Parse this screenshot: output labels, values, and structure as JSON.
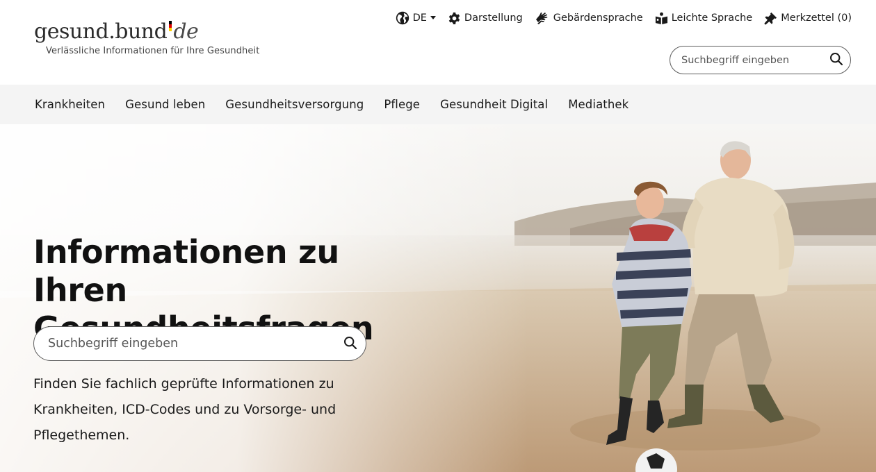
{
  "logo": {
    "main": "gesund.bund",
    "de": "de",
    "tagline": "Verlässliche Informationen für Ihre Gesundheit",
    "dot_colors": [
      "#000000",
      "#dd0000",
      "#ffce00"
    ]
  },
  "utility_nav": {
    "language": "DE",
    "display": "Darstellung",
    "sign_language": "Gebärdensprache",
    "easy_language": "Leichte Sprache",
    "bookmarks": "Merkzettel (0)"
  },
  "header_search": {
    "placeholder": "Suchbegriff eingeben"
  },
  "main_nav": {
    "items": [
      {
        "label": "Krankheiten"
      },
      {
        "label": "Gesund leben"
      },
      {
        "label": "Gesundheitsversorgung"
      },
      {
        "label": "Pflege"
      },
      {
        "label": "Gesundheit Digital"
      },
      {
        "label": "Mediathek"
      }
    ]
  },
  "hero": {
    "title": "Informationen zu Ihren Gesundheitsfragen",
    "search_placeholder": "Suchbegriff eingeben",
    "description": "Finden Sie fachlich geprüfte Informationen zu Krankheiten, ICD-Codes und zu Vorsorge- und Pflegethemen."
  },
  "colors": {
    "nav_background": "#f4f4f4",
    "text": "#1a1a1a",
    "border": "#5c5c5c"
  }
}
